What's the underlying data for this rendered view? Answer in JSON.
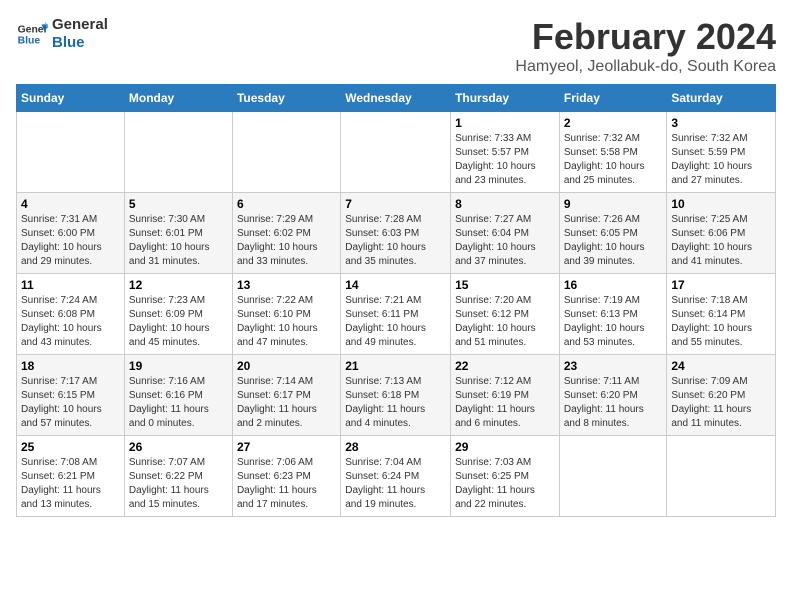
{
  "logo": {
    "line1": "General",
    "line2": "Blue"
  },
  "title": "February 2024",
  "subtitle": "Hamyeol, Jeollabuk-do, South Korea",
  "days_of_week": [
    "Sunday",
    "Monday",
    "Tuesday",
    "Wednesday",
    "Thursday",
    "Friday",
    "Saturday"
  ],
  "weeks": [
    [
      {
        "day": "",
        "info": ""
      },
      {
        "day": "",
        "info": ""
      },
      {
        "day": "",
        "info": ""
      },
      {
        "day": "",
        "info": ""
      },
      {
        "day": "1",
        "info": "Sunrise: 7:33 AM\nSunset: 5:57 PM\nDaylight: 10 hours\nand 23 minutes."
      },
      {
        "day": "2",
        "info": "Sunrise: 7:32 AM\nSunset: 5:58 PM\nDaylight: 10 hours\nand 25 minutes."
      },
      {
        "day": "3",
        "info": "Sunrise: 7:32 AM\nSunset: 5:59 PM\nDaylight: 10 hours\nand 27 minutes."
      }
    ],
    [
      {
        "day": "4",
        "info": "Sunrise: 7:31 AM\nSunset: 6:00 PM\nDaylight: 10 hours\nand 29 minutes."
      },
      {
        "day": "5",
        "info": "Sunrise: 7:30 AM\nSunset: 6:01 PM\nDaylight: 10 hours\nand 31 minutes."
      },
      {
        "day": "6",
        "info": "Sunrise: 7:29 AM\nSunset: 6:02 PM\nDaylight: 10 hours\nand 33 minutes."
      },
      {
        "day": "7",
        "info": "Sunrise: 7:28 AM\nSunset: 6:03 PM\nDaylight: 10 hours\nand 35 minutes."
      },
      {
        "day": "8",
        "info": "Sunrise: 7:27 AM\nSunset: 6:04 PM\nDaylight: 10 hours\nand 37 minutes."
      },
      {
        "day": "9",
        "info": "Sunrise: 7:26 AM\nSunset: 6:05 PM\nDaylight: 10 hours\nand 39 minutes."
      },
      {
        "day": "10",
        "info": "Sunrise: 7:25 AM\nSunset: 6:06 PM\nDaylight: 10 hours\nand 41 minutes."
      }
    ],
    [
      {
        "day": "11",
        "info": "Sunrise: 7:24 AM\nSunset: 6:08 PM\nDaylight: 10 hours\nand 43 minutes."
      },
      {
        "day": "12",
        "info": "Sunrise: 7:23 AM\nSunset: 6:09 PM\nDaylight: 10 hours\nand 45 minutes."
      },
      {
        "day": "13",
        "info": "Sunrise: 7:22 AM\nSunset: 6:10 PM\nDaylight: 10 hours\nand 47 minutes."
      },
      {
        "day": "14",
        "info": "Sunrise: 7:21 AM\nSunset: 6:11 PM\nDaylight: 10 hours\nand 49 minutes."
      },
      {
        "day": "15",
        "info": "Sunrise: 7:20 AM\nSunset: 6:12 PM\nDaylight: 10 hours\nand 51 minutes."
      },
      {
        "day": "16",
        "info": "Sunrise: 7:19 AM\nSunset: 6:13 PM\nDaylight: 10 hours\nand 53 minutes."
      },
      {
        "day": "17",
        "info": "Sunrise: 7:18 AM\nSunset: 6:14 PM\nDaylight: 10 hours\nand 55 minutes."
      }
    ],
    [
      {
        "day": "18",
        "info": "Sunrise: 7:17 AM\nSunset: 6:15 PM\nDaylight: 10 hours\nand 57 minutes."
      },
      {
        "day": "19",
        "info": "Sunrise: 7:16 AM\nSunset: 6:16 PM\nDaylight: 11 hours\nand 0 minutes."
      },
      {
        "day": "20",
        "info": "Sunrise: 7:14 AM\nSunset: 6:17 PM\nDaylight: 11 hours\nand 2 minutes."
      },
      {
        "day": "21",
        "info": "Sunrise: 7:13 AM\nSunset: 6:18 PM\nDaylight: 11 hours\nand 4 minutes."
      },
      {
        "day": "22",
        "info": "Sunrise: 7:12 AM\nSunset: 6:19 PM\nDaylight: 11 hours\nand 6 minutes."
      },
      {
        "day": "23",
        "info": "Sunrise: 7:11 AM\nSunset: 6:20 PM\nDaylight: 11 hours\nand 8 minutes."
      },
      {
        "day": "24",
        "info": "Sunrise: 7:09 AM\nSunset: 6:20 PM\nDaylight: 11 hours\nand 11 minutes."
      }
    ],
    [
      {
        "day": "25",
        "info": "Sunrise: 7:08 AM\nSunset: 6:21 PM\nDaylight: 11 hours\nand 13 minutes."
      },
      {
        "day": "26",
        "info": "Sunrise: 7:07 AM\nSunset: 6:22 PM\nDaylight: 11 hours\nand 15 minutes."
      },
      {
        "day": "27",
        "info": "Sunrise: 7:06 AM\nSunset: 6:23 PM\nDaylight: 11 hours\nand 17 minutes."
      },
      {
        "day": "28",
        "info": "Sunrise: 7:04 AM\nSunset: 6:24 PM\nDaylight: 11 hours\nand 19 minutes."
      },
      {
        "day": "29",
        "info": "Sunrise: 7:03 AM\nSunset: 6:25 PM\nDaylight: 11 hours\nand 22 minutes."
      },
      {
        "day": "",
        "info": ""
      },
      {
        "day": "",
        "info": ""
      }
    ]
  ]
}
